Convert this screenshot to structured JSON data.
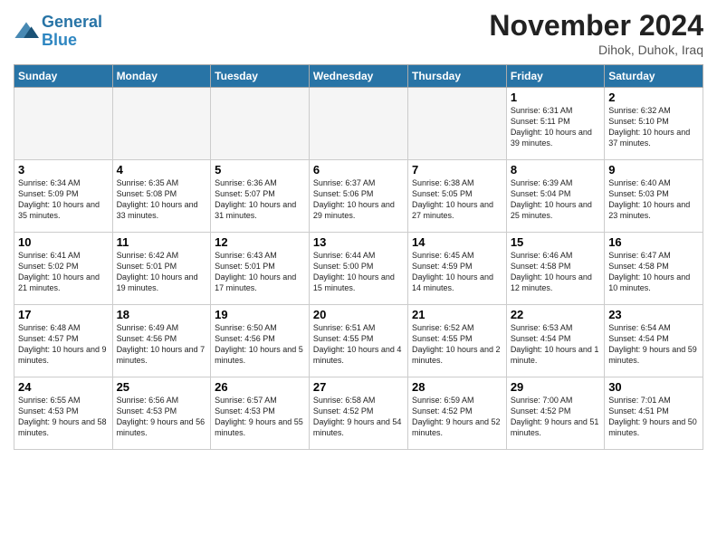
{
  "header": {
    "logo_general": "General",
    "logo_blue": "Blue",
    "month_title": "November 2024",
    "location": "Dihok, Duhok, Iraq"
  },
  "weekdays": [
    "Sunday",
    "Monday",
    "Tuesday",
    "Wednesday",
    "Thursday",
    "Friday",
    "Saturday"
  ],
  "weeks": [
    [
      {
        "day": "",
        "info": ""
      },
      {
        "day": "",
        "info": ""
      },
      {
        "day": "",
        "info": ""
      },
      {
        "day": "",
        "info": ""
      },
      {
        "day": "",
        "info": ""
      },
      {
        "day": "1",
        "info": "Sunrise: 6:31 AM\nSunset: 5:11 PM\nDaylight: 10 hours and 39 minutes."
      },
      {
        "day": "2",
        "info": "Sunrise: 6:32 AM\nSunset: 5:10 PM\nDaylight: 10 hours and 37 minutes."
      }
    ],
    [
      {
        "day": "3",
        "info": "Sunrise: 6:34 AM\nSunset: 5:09 PM\nDaylight: 10 hours and 35 minutes."
      },
      {
        "day": "4",
        "info": "Sunrise: 6:35 AM\nSunset: 5:08 PM\nDaylight: 10 hours and 33 minutes."
      },
      {
        "day": "5",
        "info": "Sunrise: 6:36 AM\nSunset: 5:07 PM\nDaylight: 10 hours and 31 minutes."
      },
      {
        "day": "6",
        "info": "Sunrise: 6:37 AM\nSunset: 5:06 PM\nDaylight: 10 hours and 29 minutes."
      },
      {
        "day": "7",
        "info": "Sunrise: 6:38 AM\nSunset: 5:05 PM\nDaylight: 10 hours and 27 minutes."
      },
      {
        "day": "8",
        "info": "Sunrise: 6:39 AM\nSunset: 5:04 PM\nDaylight: 10 hours and 25 minutes."
      },
      {
        "day": "9",
        "info": "Sunrise: 6:40 AM\nSunset: 5:03 PM\nDaylight: 10 hours and 23 minutes."
      }
    ],
    [
      {
        "day": "10",
        "info": "Sunrise: 6:41 AM\nSunset: 5:02 PM\nDaylight: 10 hours and 21 minutes."
      },
      {
        "day": "11",
        "info": "Sunrise: 6:42 AM\nSunset: 5:01 PM\nDaylight: 10 hours and 19 minutes."
      },
      {
        "day": "12",
        "info": "Sunrise: 6:43 AM\nSunset: 5:01 PM\nDaylight: 10 hours and 17 minutes."
      },
      {
        "day": "13",
        "info": "Sunrise: 6:44 AM\nSunset: 5:00 PM\nDaylight: 10 hours and 15 minutes."
      },
      {
        "day": "14",
        "info": "Sunrise: 6:45 AM\nSunset: 4:59 PM\nDaylight: 10 hours and 14 minutes."
      },
      {
        "day": "15",
        "info": "Sunrise: 6:46 AM\nSunset: 4:58 PM\nDaylight: 10 hours and 12 minutes."
      },
      {
        "day": "16",
        "info": "Sunrise: 6:47 AM\nSunset: 4:58 PM\nDaylight: 10 hours and 10 minutes."
      }
    ],
    [
      {
        "day": "17",
        "info": "Sunrise: 6:48 AM\nSunset: 4:57 PM\nDaylight: 10 hours and 9 minutes."
      },
      {
        "day": "18",
        "info": "Sunrise: 6:49 AM\nSunset: 4:56 PM\nDaylight: 10 hours and 7 minutes."
      },
      {
        "day": "19",
        "info": "Sunrise: 6:50 AM\nSunset: 4:56 PM\nDaylight: 10 hours and 5 minutes."
      },
      {
        "day": "20",
        "info": "Sunrise: 6:51 AM\nSunset: 4:55 PM\nDaylight: 10 hours and 4 minutes."
      },
      {
        "day": "21",
        "info": "Sunrise: 6:52 AM\nSunset: 4:55 PM\nDaylight: 10 hours and 2 minutes."
      },
      {
        "day": "22",
        "info": "Sunrise: 6:53 AM\nSunset: 4:54 PM\nDaylight: 10 hours and 1 minute."
      },
      {
        "day": "23",
        "info": "Sunrise: 6:54 AM\nSunset: 4:54 PM\nDaylight: 9 hours and 59 minutes."
      }
    ],
    [
      {
        "day": "24",
        "info": "Sunrise: 6:55 AM\nSunset: 4:53 PM\nDaylight: 9 hours and 58 minutes."
      },
      {
        "day": "25",
        "info": "Sunrise: 6:56 AM\nSunset: 4:53 PM\nDaylight: 9 hours and 56 minutes."
      },
      {
        "day": "26",
        "info": "Sunrise: 6:57 AM\nSunset: 4:53 PM\nDaylight: 9 hours and 55 minutes."
      },
      {
        "day": "27",
        "info": "Sunrise: 6:58 AM\nSunset: 4:52 PM\nDaylight: 9 hours and 54 minutes."
      },
      {
        "day": "28",
        "info": "Sunrise: 6:59 AM\nSunset: 4:52 PM\nDaylight: 9 hours and 52 minutes."
      },
      {
        "day": "29",
        "info": "Sunrise: 7:00 AM\nSunset: 4:52 PM\nDaylight: 9 hours and 51 minutes."
      },
      {
        "day": "30",
        "info": "Sunrise: 7:01 AM\nSunset: 4:51 PM\nDaylight: 9 hours and 50 minutes."
      }
    ]
  ]
}
